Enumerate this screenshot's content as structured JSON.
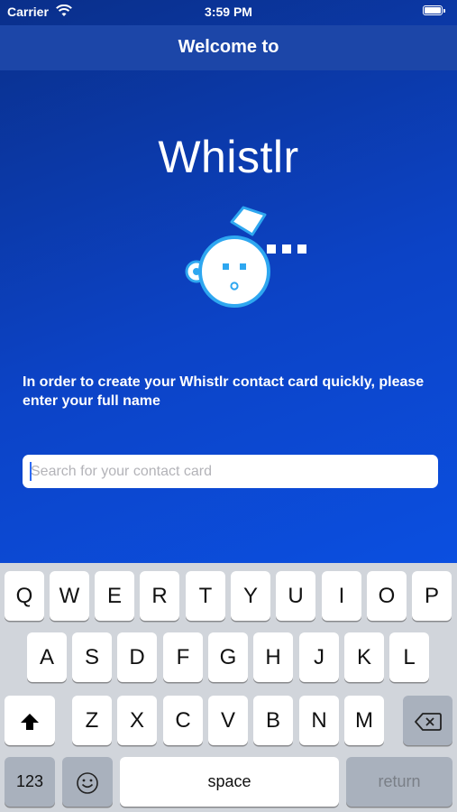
{
  "status_bar": {
    "carrier": "Carrier",
    "time": "3:59 PM"
  },
  "nav": {
    "title": "Welcome to"
  },
  "brand": {
    "name": "Whistlr",
    "logo_icon": "whistle-face-icon"
  },
  "instructions": "In order to create your Whistlr contact card quickly, please enter your full name",
  "search": {
    "placeholder": "Search for your contact card",
    "value": ""
  },
  "keyboard": {
    "row1": [
      "Q",
      "W",
      "E",
      "R",
      "T",
      "Y",
      "U",
      "I",
      "O",
      "P"
    ],
    "row2": [
      "A",
      "S",
      "D",
      "F",
      "G",
      "H",
      "J",
      "K",
      "L"
    ],
    "row3": [
      "Z",
      "X",
      "C",
      "V",
      "B",
      "N",
      "M"
    ],
    "shift_icon": "shift-arrow-icon",
    "delete_icon": "backspace-icon",
    "numbers_label": "123",
    "emoji_icon": "emoji-icon",
    "space_label": "space",
    "return_label": "return"
  },
  "colors": {
    "primary": "#0c43c6",
    "nav": "#1c46a8",
    "accent": "#2ea7f0"
  }
}
